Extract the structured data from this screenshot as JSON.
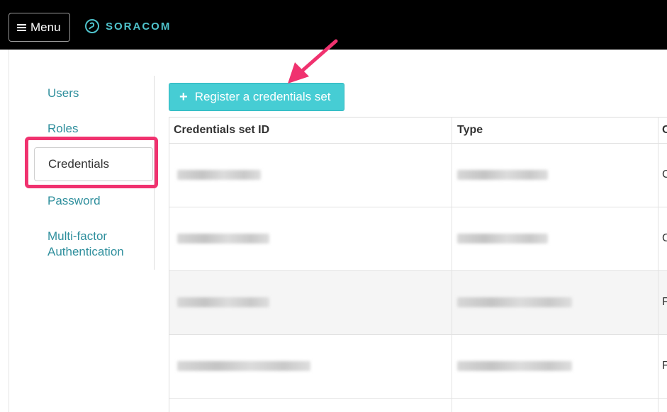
{
  "header": {
    "menu_label": "Menu",
    "logo_text": "SORACOM",
    "menu_icon": "hamburger-icon",
    "logo_icon": "soracom-logo-icon"
  },
  "sidebar": {
    "items": [
      {
        "label": "Users"
      },
      {
        "label": "Roles"
      },
      {
        "label": "Credentials",
        "active": true
      },
      {
        "label": "Password"
      },
      {
        "label": "Multi-factor Authentication"
      }
    ]
  },
  "main": {
    "register_label": "Register a credentials set",
    "register_icon": "plus-icon",
    "table": {
      "headers": [
        "Credentials set ID",
        "Type",
        "C"
      ],
      "rows": [
        {
          "third": "C"
        },
        {
          "third": "C"
        },
        {
          "third": "F"
        },
        {
          "third": "F"
        }
      ]
    }
  },
  "colors": {
    "accent": "#46cdd4",
    "link": "#2f8f9d",
    "highlight": "#f0326f",
    "topbar": "#000000"
  }
}
